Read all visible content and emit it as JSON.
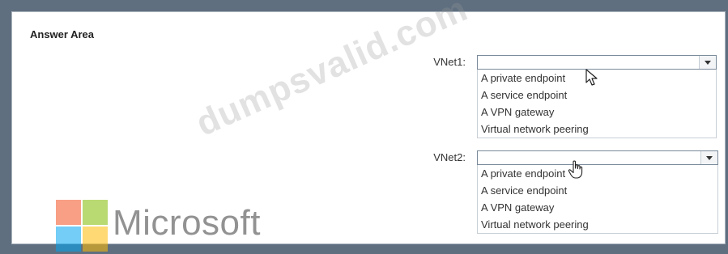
{
  "answer_area": {
    "title": "Answer Area"
  },
  "vnet1": {
    "label": "VNet1:",
    "selected": "",
    "options": [
      "A private endpoint",
      "A service endpoint",
      "A VPN gateway",
      "Virtual network peering"
    ]
  },
  "vnet2": {
    "label": "VNet2:",
    "selected": "",
    "options": [
      "A private endpoint",
      "A service endpoint",
      "A VPN gateway",
      "Virtual network peering"
    ]
  },
  "watermark": {
    "text": "dumpsvalid.com"
  },
  "brand": {
    "word": "Microsoft",
    "colors": {
      "red": "#f25022",
      "green": "#7fba00",
      "blue": "#00a4ef",
      "yellow": "#ffb900"
    }
  },
  "icons": [
    "chevron-down-icon",
    "arrow-cursor-icon",
    "hand-cursor-icon",
    "microsoft-logo-icon"
  ]
}
